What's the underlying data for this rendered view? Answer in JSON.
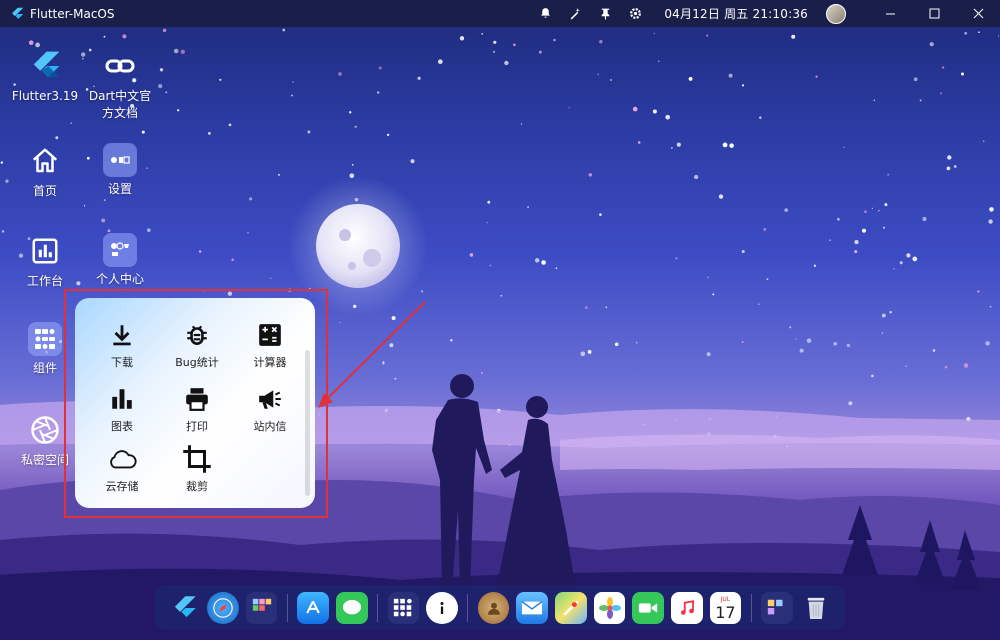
{
  "window": {
    "title": "Flutter-MacOS",
    "datetime": "04月12日 周五 21:10:36"
  },
  "desktop": {
    "icons": [
      {
        "label": "Flutter3.19",
        "icon": "flutter-logo-icon"
      },
      {
        "label": "Dart中文官方文档",
        "icon": "link-icon"
      },
      {
        "label": "首页",
        "icon": "home-icon"
      },
      {
        "label": "设置",
        "icon": "settings-tile-icon"
      },
      {
        "label": "工作台",
        "icon": "chart-icon"
      },
      {
        "label": "个人中心",
        "icon": "profile-tile-icon"
      },
      {
        "label": "组件",
        "icon": "widgets-tile-icon"
      },
      {
        "label": "私密空间",
        "icon": "aperture-icon"
      }
    ]
  },
  "popup": {
    "items": [
      {
        "label": "下载",
        "icon": "download-icon"
      },
      {
        "label": "Bug统计",
        "icon": "bug-icon"
      },
      {
        "label": "计算器",
        "icon": "calculator-icon"
      },
      {
        "label": "图表",
        "icon": "bar-chart-icon"
      },
      {
        "label": "打印",
        "icon": "printer-icon"
      },
      {
        "label": "站内信",
        "icon": "megaphone-icon"
      },
      {
        "label": "云存储",
        "icon": "cloud-icon"
      },
      {
        "label": "裁剪",
        "icon": "crop-icon"
      }
    ]
  },
  "dock": {
    "calendar_month": "JUL",
    "calendar_day": "17"
  },
  "colors": {
    "highlight": "#e0303a",
    "titlebar": "#1a1f4a"
  }
}
